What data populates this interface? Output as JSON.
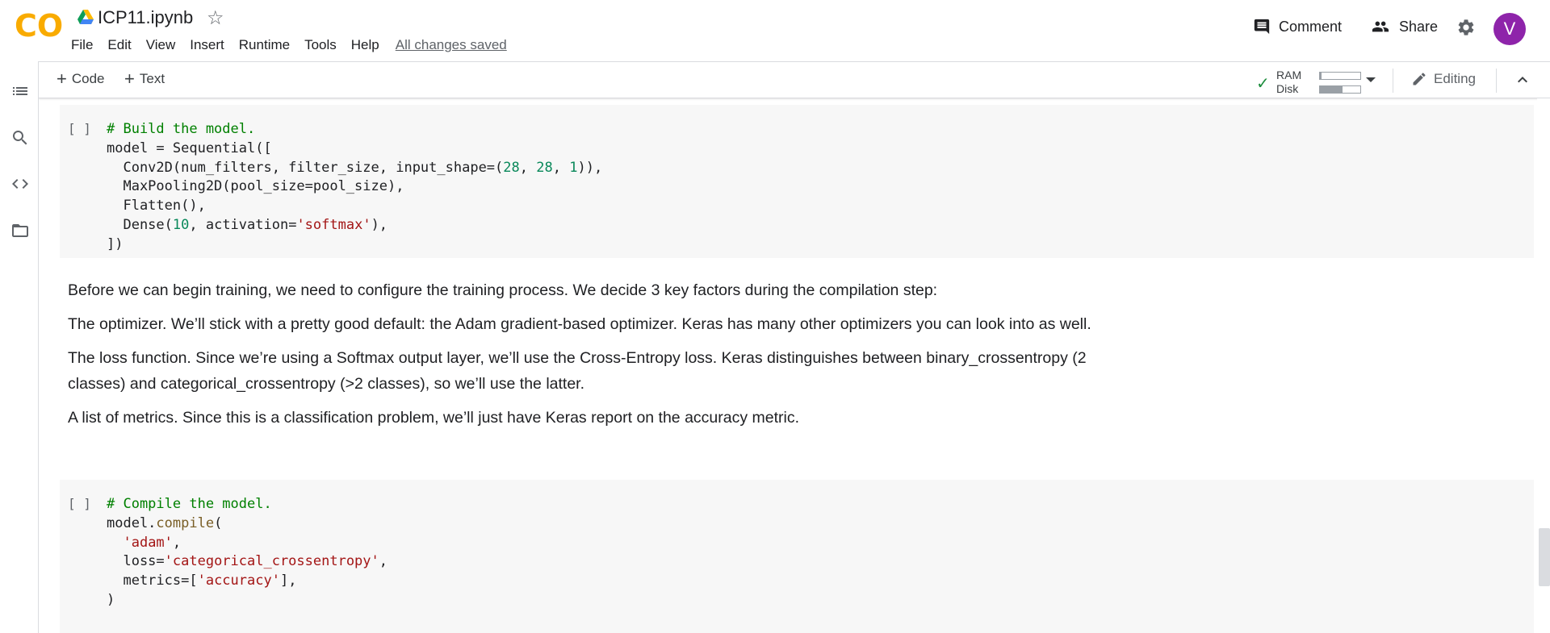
{
  "header": {
    "logo_text": "CO",
    "doc_title": "ICP11.ipynb",
    "menu": [
      "File",
      "Edit",
      "View",
      "Insert",
      "Runtime",
      "Tools",
      "Help"
    ],
    "save_status": "All changes saved",
    "comment_label": "Comment",
    "share_label": "Share",
    "avatar_initial": "V"
  },
  "toolbar": {
    "add_code_label": "Code",
    "add_text_label": "Text",
    "ram_label": "RAM",
    "disk_label": "Disk",
    "ram_usage": 0.03,
    "disk_usage": 0.55,
    "editing_label": "Editing"
  },
  "colors": {
    "accent": "#f9ab00",
    "avatar": "#8e24aa",
    "connected": "#1e8e3e",
    "comment": "#008000",
    "number": "#09885a",
    "string": "#a31515"
  },
  "cells": {
    "cell1": {
      "run": "[ ]",
      "lines": [
        [
          {
            "t": "# Build the model.",
            "c": "com"
          }
        ],
        [
          {
            "t": "model = Sequential(["
          }
        ],
        [
          {
            "t": "  Conv2D(num_filters, filter_size, input_shape=("
          },
          {
            "t": "28",
            "c": "num"
          },
          {
            "t": ", "
          },
          {
            "t": "28",
            "c": "num"
          },
          {
            "t": ", "
          },
          {
            "t": "1",
            "c": "num"
          },
          {
            "t": ")),"
          }
        ],
        [
          {
            "t": "  MaxPooling2D(pool_size=pool_size),"
          }
        ],
        [
          {
            "t": "  Flatten(),"
          }
        ],
        [
          {
            "t": "  Dense("
          },
          {
            "t": "10",
            "c": "num"
          },
          {
            "t": ", activation="
          },
          {
            "t": "'softmax'",
            "c": "str"
          },
          {
            "t": "),"
          }
        ],
        [
          {
            "t": "])"
          }
        ]
      ]
    },
    "text": {
      "p1": "Before we can begin training, we need to configure the training process. We decide 3 key factors during the compilation step:",
      "p2": "The optimizer. We’ll stick with a pretty good default: the Adam gradient-based optimizer. Keras has many other optimizers you can look into as well.",
      "p3": "The loss function. Since we’re using a Softmax output layer, we’ll use the Cross-Entropy loss. Keras distinguishes between binary_crossentropy (2 classes) and categorical_crossentropy (>2 classes), so we’ll use the latter.",
      "p4": "A list of metrics. Since this is a classification problem, we’ll just have Keras report on the accuracy metric."
    },
    "cell2": {
      "run": "[ ]",
      "lines": [
        [
          {
            "t": "# Compile the model.",
            "c": "com"
          }
        ],
        [
          {
            "t": "model."
          },
          {
            "t": "compile",
            "c": "fn"
          },
          {
            "t": "("
          }
        ],
        [
          {
            "t": "  "
          },
          {
            "t": "'adam'",
            "c": "str"
          },
          {
            "t": ","
          }
        ],
        [
          {
            "t": "  loss="
          },
          {
            "t": "'categorical_crossentropy'",
            "c": "str"
          },
          {
            "t": ","
          }
        ],
        [
          {
            "t": "  metrics=["
          },
          {
            "t": "'accuracy'",
            "c": "str"
          },
          {
            "t": "],"
          }
        ],
        [
          {
            "t": ")"
          }
        ]
      ]
    }
  }
}
